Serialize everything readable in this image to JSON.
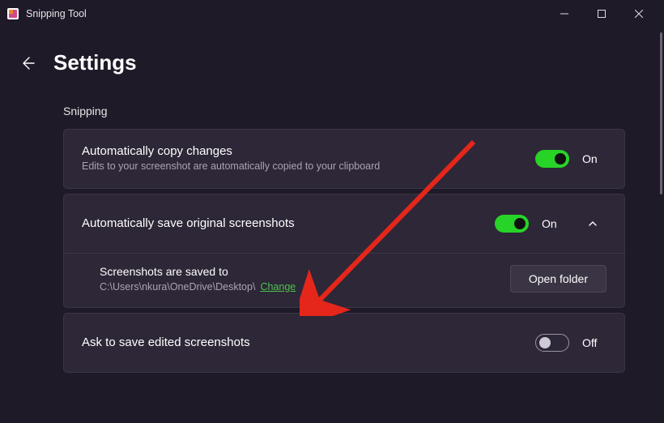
{
  "window": {
    "title": "Snipping Tool"
  },
  "page": {
    "title": "Settings"
  },
  "section": {
    "label": "Snipping"
  },
  "settings": {
    "autoCopy": {
      "title": "Automatically copy changes",
      "subtitle": "Edits to your screenshot are automatically copied to your clipboard",
      "stateLabel": "On"
    },
    "autoSave": {
      "title": "Automatically save original screenshots",
      "stateLabel": "On",
      "saveLocation": {
        "title": "Screenshots are saved to",
        "path": "C:\\Users\\nkura\\OneDrive\\Desktop\\",
        "changeLabel": "Change",
        "openFolderLabel": "Open folder"
      }
    },
    "askSave": {
      "title": "Ask to save edited screenshots",
      "stateLabel": "Off"
    }
  }
}
